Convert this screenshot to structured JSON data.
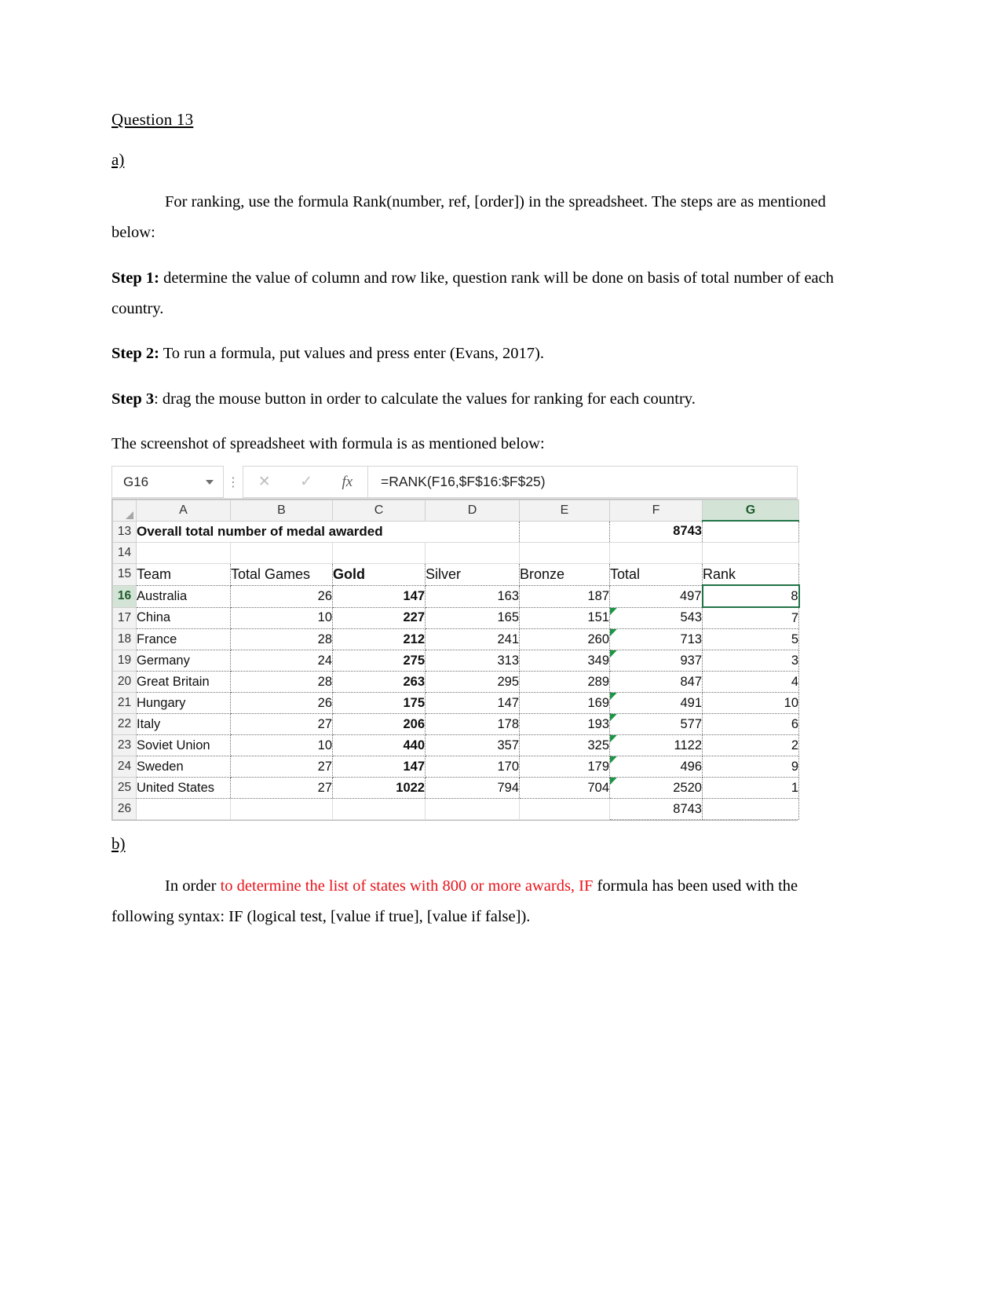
{
  "document": {
    "title": "Question 13",
    "part_a_label": "a)",
    "intro": "For ranking, use the formula Rank(number, ref, [order]) in the spreadsheet. The steps are as mentioned below:",
    "step1_label": "Step 1:",
    "step1_text": " determine the value of column and row like, question rank will be done on basis of total number of each country.",
    "step2_label": "Step 2:",
    "step2_text": " To run a formula, put values and press enter (Evans, 2017).",
    "step3_label": "Step 3",
    "step3_text": ": drag the mouse button in order to calculate the values for ranking for each country.",
    "screenshot_caption": "The screenshot of spreadsheet with formula is as mentioned below:",
    "part_b_label": "b)",
    "part_b_pre": "In order ",
    "part_b_red": "to determine the list of states with 800 or more awards, IF",
    "part_b_post": " formula has been used with the following syntax: IF (logical test, [value if true], [value if false]).",
    "red_color": "#e8131a"
  },
  "spreadsheet": {
    "name_box": "G16",
    "formula": "=RANK(F16,$F$16:$F$25)",
    "cancel_icon": "✕",
    "enter_icon": "✓",
    "fx_icon": "fx",
    "dots_icon": "⋮",
    "dropdown_icon": "chevron-down",
    "column_headers": [
      "A",
      "B",
      "C",
      "D",
      "E",
      "F",
      "G"
    ],
    "selected_column": "G",
    "selected_cell": "G16",
    "accent_color": "#217346",
    "row_numbers": [
      "13",
      "14",
      "15",
      "16",
      "17",
      "18",
      "19",
      "20",
      "21",
      "22",
      "23",
      "24",
      "25",
      "26"
    ],
    "row13_title": "Overall total number of medal awarded",
    "row13_total": "8743",
    "headers": [
      "Team",
      "Total Games",
      "Gold",
      "Silver",
      "Bronze",
      "Total",
      "Rank"
    ],
    "rows": [
      {
        "row": "16",
        "team": "Australia",
        "games": "26",
        "gold": "147",
        "silver": "163",
        "bronze": "187",
        "total": "497",
        "rank": "8"
      },
      {
        "row": "17",
        "team": "China",
        "games": "10",
        "gold": "227",
        "silver": "165",
        "bronze": "151",
        "total": "543",
        "rank": "7"
      },
      {
        "row": "18",
        "team": "France",
        "games": "28",
        "gold": "212",
        "silver": "241",
        "bronze": "260",
        "total": "713",
        "rank": "5"
      },
      {
        "row": "19",
        "team": "Germany",
        "games": "24",
        "gold": "275",
        "silver": "313",
        "bronze": "349",
        "total": "937",
        "rank": "3"
      },
      {
        "row": "20",
        "team": "Great Britain",
        "games": "28",
        "gold": "263",
        "silver": "295",
        "bronze": "289",
        "total": "847",
        "rank": "4"
      },
      {
        "row": "21",
        "team": "Hungary",
        "games": "26",
        "gold": "175",
        "silver": "147",
        "bronze": "169",
        "total": "491",
        "rank": "10"
      },
      {
        "row": "22",
        "team": "Italy",
        "games": "27",
        "gold": "206",
        "silver": "178",
        "bronze": "193",
        "total": "577",
        "rank": "6"
      },
      {
        "row": "23",
        "team": "Soviet Union",
        "games": "10",
        "gold": "440",
        "silver": "357",
        "bronze": "325",
        "total": "1122",
        "rank": "2"
      },
      {
        "row": "24",
        "team": "Sweden",
        "games": "27",
        "gold": "147",
        "silver": "170",
        "bronze": "179",
        "total": "496",
        "rank": "9"
      },
      {
        "row": "25",
        "team": "United States",
        "games": "27",
        "gold": "1022",
        "silver": "794",
        "bronze": "704",
        "total": "2520",
        "rank": "1"
      }
    ],
    "row26_total": "8743"
  }
}
